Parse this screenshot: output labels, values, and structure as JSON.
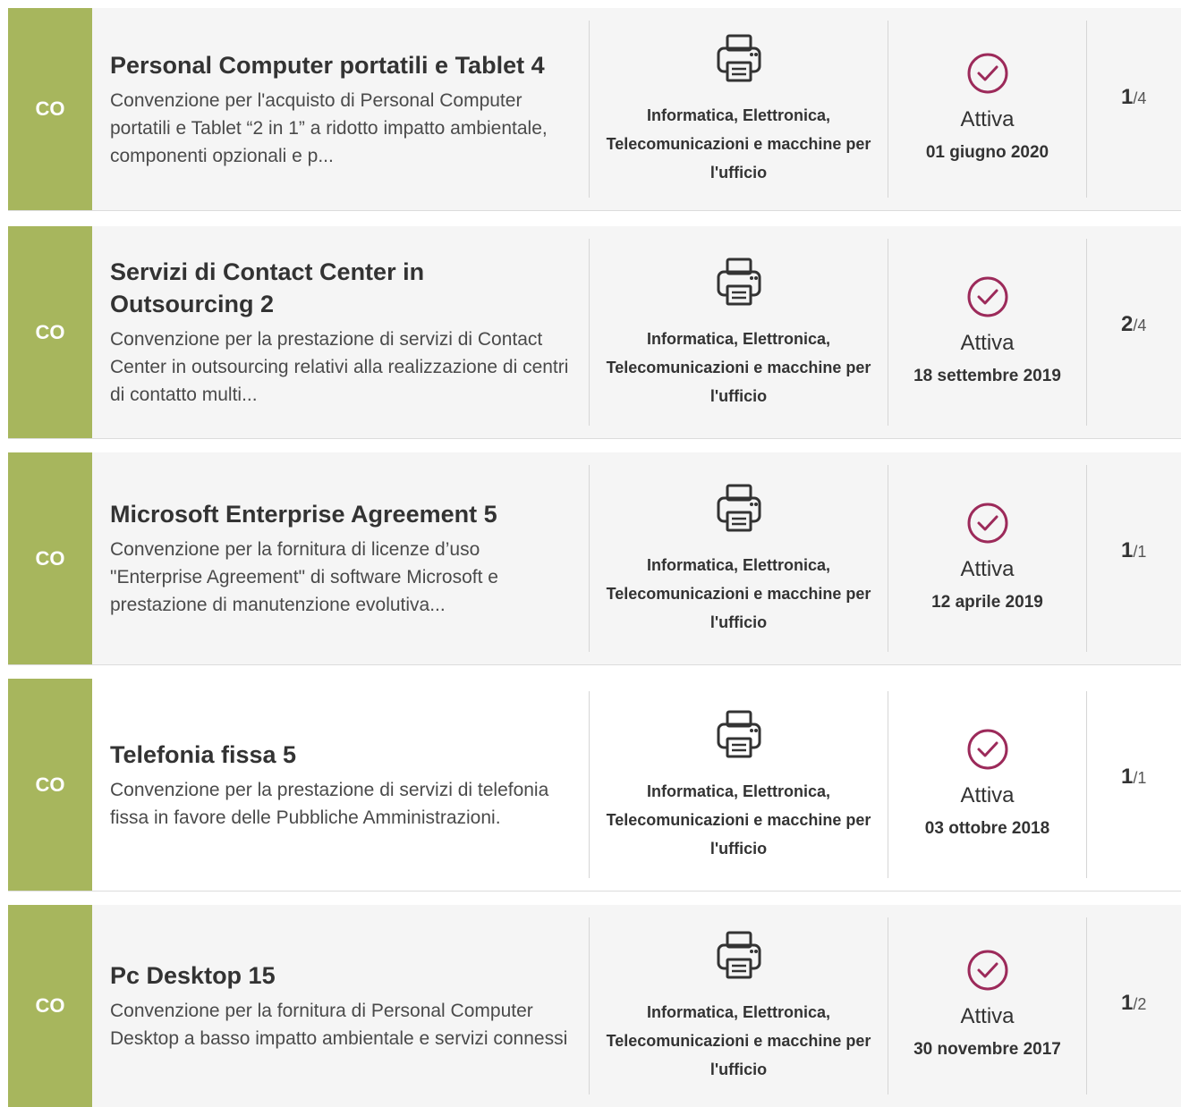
{
  "colors": {
    "badge": "#a7b65d",
    "status_icon": "#9c2a5a",
    "card_background": "#f5f5f5"
  },
  "cards": [
    {
      "badge": "CO",
      "title": "Personal Computer portatili e Tablet 4",
      "description": "Convenzione per l'acquisto di Personal Computer portatili e Tablet “2 in 1” a ridotto impatto ambientale, componenti opzionali e p...",
      "category_icon": "printer-icon",
      "category": "Informatica, Elettronica, Telecomunicazioni e macchine per l'ufficio",
      "status_icon": "check-circle-icon",
      "status": "Attiva",
      "date": "01 giugno 2020",
      "page_current": "1",
      "page_separator": "/",
      "page_total": "4"
    },
    {
      "badge": "CO",
      "title": "Servizi di Contact Center in Outsourcing 2",
      "description": "Convenzione per la prestazione di servizi di Contact Center in outsourcing relativi alla realizzazione di centri di contatto multi...",
      "category_icon": "printer-icon",
      "category": "Informatica, Elettronica, Telecomunicazioni e macchine per l'ufficio",
      "status_icon": "check-circle-icon",
      "status": "Attiva",
      "date": "18 settembre 2019",
      "page_current": "2",
      "page_separator": "/",
      "page_total": "4"
    },
    {
      "badge": "CO",
      "title": "Microsoft Enterprise Agreement 5",
      "description": "Convenzione per la fornitura di licenze d’uso \"Enterprise Agreement\" di software Microsoft e prestazione di manutenzione evolutiva...",
      "category_icon": "printer-icon",
      "category": "Informatica, Elettronica, Telecomunicazioni e macchine per l'ufficio",
      "status_icon": "check-circle-icon",
      "status": "Attiva",
      "date": "12 aprile 2019",
      "page_current": "1",
      "page_separator": "/",
      "page_total": "1"
    },
    {
      "badge": "CO",
      "title": "Telefonia fissa 5",
      "description": "Convenzione per la prestazione di servizi di telefonia fissa in favore delle Pubbliche Amministrazioni.",
      "category_icon": "printer-icon",
      "category": "Informatica, Elettronica, Telecomunicazioni e macchine per l'ufficio",
      "status_icon": "check-circle-icon",
      "status": "Attiva",
      "date": "03 ottobre 2018",
      "page_current": "1",
      "page_separator": "/",
      "page_total": "1"
    },
    {
      "badge": "CO",
      "title": "Pc Desktop 15",
      "description": "Convenzione per la fornitura di Personal Computer Desktop a basso impatto ambientale e servizi connessi",
      "category_icon": "printer-icon",
      "category": "Informatica, Elettronica, Telecomunicazioni e macchine per l'ufficio",
      "status_icon": "check-circle-icon",
      "status": "Attiva",
      "date": "30 novembre 2017",
      "page_current": "1",
      "page_separator": "/",
      "page_total": "2"
    }
  ]
}
